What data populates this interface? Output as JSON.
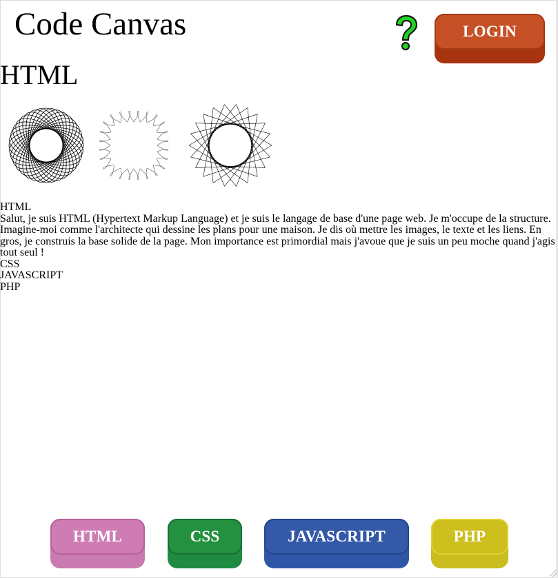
{
  "header": {
    "title": "Code Canvas",
    "help_icon": "question-mark-icon",
    "login_label": "LOGIN"
  },
  "section": {
    "heading": "HTML",
    "images": [
      "spirograph-rosette-icon",
      "spirograph-square-loops-icon",
      "spirograph-star-icon"
    ],
    "items": [
      {
        "title": "HTML",
        "description": "Salut, je suis HTML (Hypertext Markup Language) et je suis le langage de base d'une page web. Je m'occupe de la structure. Imagine-moi comme l'architecte qui dessine les plans pour une maison. Je dis où mettre les images, le texte et les liens. En gros, je construis la base solide de la page. Mon importance est primordial mais j'avoue que je suis un peu moche quand j'agis tout seul !"
      },
      {
        "title": "CSS"
      },
      {
        "title": "JAVASCRIPT"
      },
      {
        "title": "PHP"
      }
    ]
  },
  "nav": {
    "buttons": [
      {
        "label": "HTML",
        "color": "#cf7cb4"
      },
      {
        "label": "CSS",
        "color": "#23913f"
      },
      {
        "label": "JAVASCRIPT",
        "color": "#3359a8"
      },
      {
        "label": "PHP",
        "color": "#cdbf1e"
      }
    ]
  },
  "colors": {
    "login": "#c75127",
    "help_icon_fill": "#22d322"
  }
}
